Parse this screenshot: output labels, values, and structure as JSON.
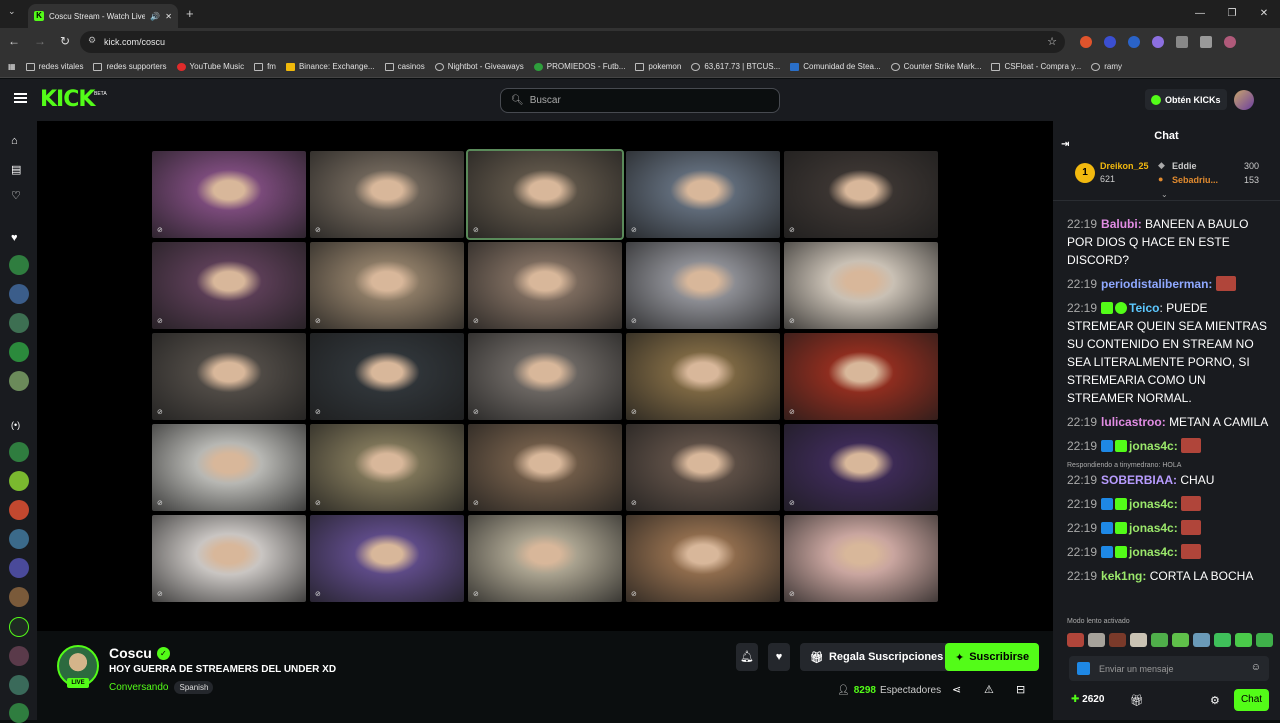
{
  "browser": {
    "tab_title": "Coscu Stream - Watch Live",
    "url": "kick.com/coscu",
    "bookmarks": [
      "redes vitales",
      "redes supporters",
      "YouTube Music",
      "fm",
      "Binance: Exchange...",
      "casinos",
      "Nightbot - Giveaways",
      "PROMIEDOS - Futb...",
      "pokemon",
      "63,617.73 | BTCUS...",
      "Comunidad de Stea...",
      "Counter Strike Mark...",
      "CSFloat - Compra y...",
      "ramy"
    ]
  },
  "header": {
    "logo": "KICK",
    "beta": "BETA",
    "search_placeholder": "Buscar",
    "get_kicks": "Obtén KICKs"
  },
  "stream": {
    "streamer": "Coscu",
    "live": "LIVE",
    "title": "HOY GUERRA DE STREAMERS DEL UNDER XD",
    "category": "Conversando",
    "language": "Spanish",
    "gift_label": "Regala Suscripciones",
    "subscribe_label": "Suscribirse",
    "viewers_count": "8298",
    "viewers_label": "Espectadores"
  },
  "chat": {
    "title": "Chat",
    "leaderboard": {
      "rank": "1",
      "gifters": [
        {
          "name": "Dreikon_25",
          "value": "621"
        },
        {
          "name": "Eddie",
          "value": "300"
        },
        {
          "name": "Sebadriu...",
          "value": "153"
        }
      ]
    },
    "messages": [
      {
        "time": "22:19",
        "user": "Balubi:",
        "text": "BANEEN A BAULO POR DIOS Q HACE EN ESTE DISCORD?"
      },
      {
        "time": "22:19",
        "user": "periodistaliberman:",
        "text": ""
      },
      {
        "time": "22:19",
        "user": "Teico",
        "text": ": PUEDE STREMEAR QUEIN SEA MIENTRAS SU CONTENIDO EN STREAM NO SEA LITERALMENTE PORNO, SI STREMEARIA COMO UN STREAMER NORMAL."
      },
      {
        "time": "22:19",
        "user": "lulicastroo:",
        "text": "METAN A CAMILA"
      },
      {
        "time": "22:19",
        "user": "jonas4c:",
        "text": ""
      },
      {
        "reply": "Respondiendo a tinymedrano: HOLA",
        "time": "22:19",
        "user": "SOBERBIAA:",
        "text": "CHAU"
      },
      {
        "time": "22:19",
        "user": "jonas4c:",
        "text": ""
      },
      {
        "time": "22:19",
        "user": "jonas4c:",
        "text": ""
      },
      {
        "time": "22:19",
        "user": "jonas4c:",
        "text": ""
      },
      {
        "time": "22:19",
        "user": "kek1ng:",
        "text": "CORTA LA BOCHA"
      }
    ],
    "slow_mode": "Modo lento activado",
    "input_placeholder": "Enviar un mensaje",
    "kicks_balance": "2620",
    "send_label": "Chat"
  },
  "video_grid": {
    "tiles": [
      "#7a4a7a",
      "#6d6358",
      "#5c5347",
      "#5f6a78",
      "#3a3431",
      "#5a3d55",
      "#8a7964",
      "#7b6a5d",
      "#8b8c92",
      "#c9c0b4",
      "#4f4a45",
      "#2f3438",
      "#6a6561",
      "#7b6642",
      "#8e2d1f",
      "#b7b7b3",
      "#7c7357",
      "#6e5a47",
      "#5c4e45",
      "#3c2a55",
      "#c9c5c2",
      "#5d4a86",
      "#a8a18e",
      "#8e6b4c",
      "#c9a59f"
    ]
  }
}
